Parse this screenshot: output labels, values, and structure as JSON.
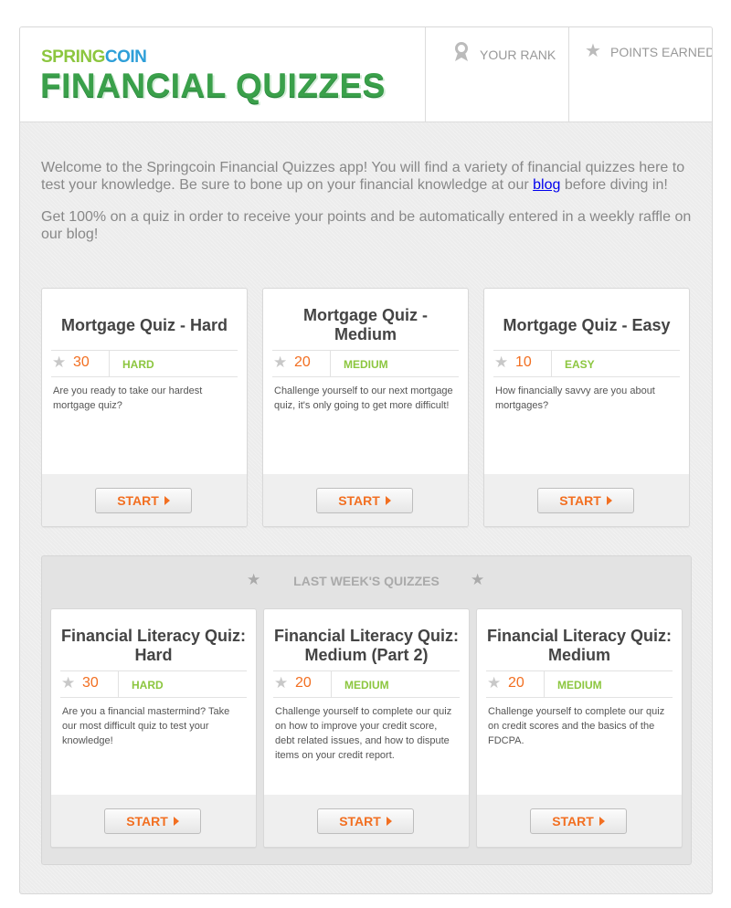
{
  "header": {
    "logo_spring": "SPRING",
    "logo_coin": "COIN",
    "title": "FINANCIAL QUIZZES",
    "rank_label": "YOUR RANK",
    "rank_icon": "person-icon",
    "points_label": "POINTS EARNED",
    "points_icon": "star-icon"
  },
  "intro": {
    "p1_before": "Welcome to the Springcoin Financial Quizzes app! You will find a variety of financial quizzes here to test your knowledge. Be sure to bone up on your financial knowledge at our ",
    "p1_link": "blog",
    "p1_after": " before diving in!",
    "p2": "Get 100% on a quiz in order to receive your points and be automatically entered in a weekly raffle on our blog!"
  },
  "quizzes": [
    {
      "title": "Mortgage Quiz - Hard",
      "points": "30",
      "level": "HARD",
      "description": "Are you ready to take our hardest mortgage quiz?",
      "button": "START"
    },
    {
      "title": "Mortgage Quiz - Medium",
      "points": "20",
      "level": "MEDIUM",
      "description": "Challenge yourself to our next mortgage quiz, it's only going to get more difficult!",
      "button": "START"
    },
    {
      "title": "Mortgage Quiz - Easy",
      "points": "10",
      "level": "EASY",
      "description": "How financially savvy are you about mortgages?",
      "button": "START"
    }
  ],
  "last_week": {
    "heading": "LAST WEEK'S QUIZZES",
    "quizzes": [
      {
        "title": "Financial Literacy Quiz: Hard",
        "points": "30",
        "level": "HARD",
        "description": "Are you a financial mastermind? Take our most difficult quiz to test your knowledge!",
        "button": "START"
      },
      {
        "title": "Financial Literacy Quiz: Medium (Part 2)",
        "points": "20",
        "level": "MEDIUM",
        "description": "Challenge yourself to complete our quiz on how to improve your credit score, debt related issues, and how to dispute items on your credit report.",
        "button": "START"
      },
      {
        "title": "Financial Literacy Quiz: Medium",
        "points": "20",
        "level": "MEDIUM",
        "description": "Challenge yourself to complete our quiz on credit scores and the basics of the FDCPA.",
        "button": "START"
      }
    ]
  },
  "colors": {
    "accent_orange": "#f26f21",
    "brand_green": "#3aa04a",
    "level_green": "#8cc63f",
    "brand_blue": "#2e9fd8"
  }
}
